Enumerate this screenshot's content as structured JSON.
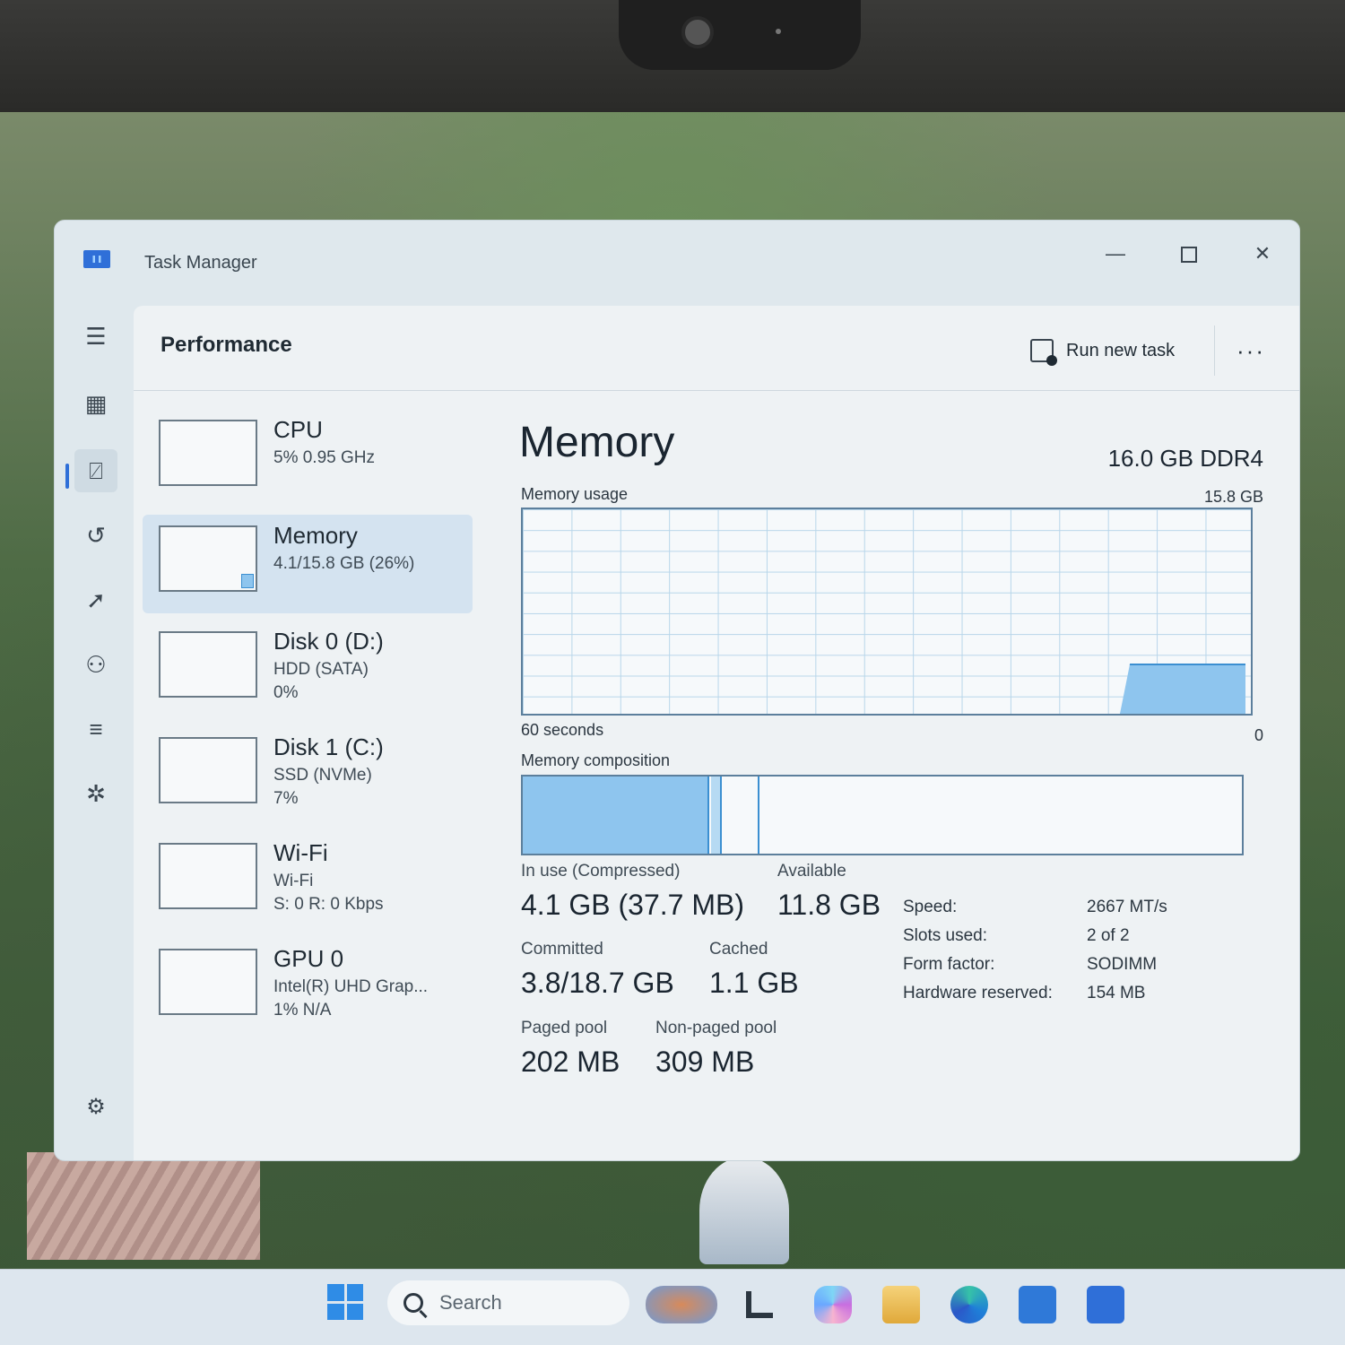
{
  "window": {
    "title": "Task Manager",
    "minimize_label": "—",
    "close_label": "✕"
  },
  "header": {
    "title": "Performance",
    "run_new_task": "Run new task",
    "more": "···"
  },
  "rail": {
    "items": [
      {
        "icon": "hamburger-menu-icon",
        "glyph": "☰"
      },
      {
        "icon": "processes-icon",
        "glyph": "▦"
      },
      {
        "icon": "performance-icon",
        "glyph": "⍁"
      },
      {
        "icon": "app-history-icon",
        "glyph": "↺"
      },
      {
        "icon": "startup-apps-icon",
        "glyph": "➚"
      },
      {
        "icon": "users-icon",
        "glyph": "⚇"
      },
      {
        "icon": "details-icon",
        "glyph": "≡"
      },
      {
        "icon": "services-icon",
        "glyph": "✲"
      }
    ],
    "settings_glyph": "⚙"
  },
  "resources": [
    {
      "name": "CPU",
      "sub": "5% 0.95 GHz",
      "sub2": ""
    },
    {
      "name": "Memory",
      "sub": "4.1/15.8 GB (26%)",
      "sub2": ""
    },
    {
      "name": "Disk 0 (D:)",
      "sub": "HDD (SATA)",
      "sub2": "0%"
    },
    {
      "name": "Disk 1 (C:)",
      "sub": "SSD (NVMe)",
      "sub2": "7%"
    },
    {
      "name": "Wi-Fi",
      "sub": "Wi-Fi",
      "sub2": "S: 0 R: 0 Kbps"
    },
    {
      "name": "GPU 0",
      "sub": "Intel(R) UHD Grap...",
      "sub2": "1% N/A"
    }
  ],
  "memory": {
    "title": "Memory",
    "spec": "16.0 GB DDR4",
    "usage_label": "Memory usage",
    "usage_max": "15.8 GB",
    "x_left": "60 seconds",
    "x_right": "0",
    "composition_label": "Memory composition",
    "in_use_label": "In use (Compressed)",
    "in_use_value": "4.1 GB (37.7 MB)",
    "available_label": "Available",
    "available_value": "11.8 GB",
    "committed_label": "Committed",
    "committed_value": "3.8/18.7 GB",
    "cached_label": "Cached",
    "cached_value": "1.1 GB",
    "paged_label": "Paged pool",
    "paged_value": "202 MB",
    "nonpaged_label": "Non-paged pool",
    "nonpaged_value": "309 MB",
    "specs": [
      {
        "k": "Speed:",
        "v": "2667 MT/s"
      },
      {
        "k": "Slots used:",
        "v": "2 of 2"
      },
      {
        "k": "Form factor:",
        "v": "SODIMM"
      },
      {
        "k": "Hardware reserved:",
        "v": "154 MB"
      }
    ]
  },
  "taskbar": {
    "search_placeholder": "Search"
  },
  "colors": {
    "accent": "#2f6fd8",
    "graph_fill": "#8ec5ee",
    "graph_line": "#3b8fd1"
  }
}
